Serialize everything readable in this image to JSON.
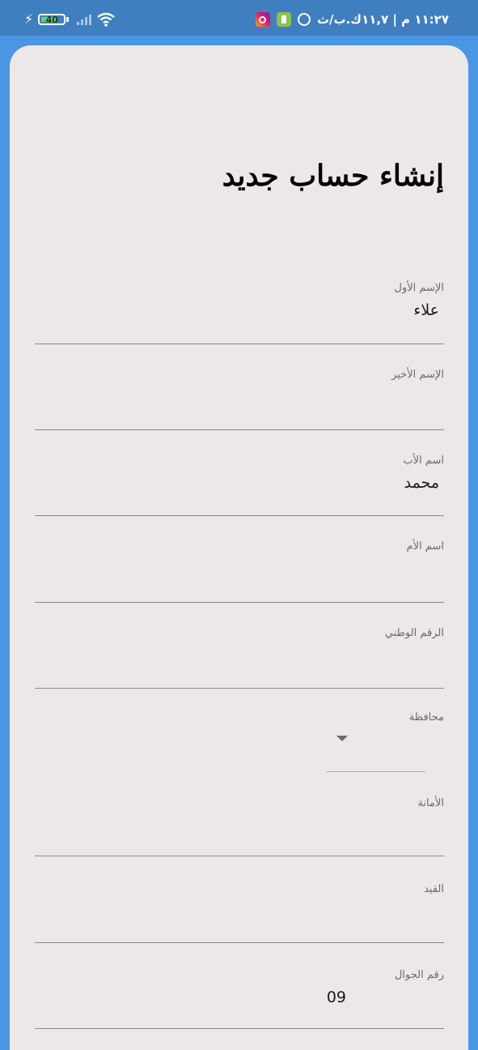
{
  "status_bar": {
    "battery_level": "40",
    "time_text": "١١:٢٧ م | ١١,٧ك.ب/ث",
    "icons": [
      "charging-bolt-icon",
      "battery-icon",
      "signal-icon",
      "wifi-icon",
      "instagram-icon",
      "app-icon",
      "alarm-icon"
    ]
  },
  "form": {
    "title": "إنشاء حساب جديد",
    "fields": [
      {
        "label": "الإسم الأول",
        "value": "علاء"
      },
      {
        "label": "الإسم الأخير",
        "value": ""
      },
      {
        "label": "اسم الأب",
        "value": "محمد"
      },
      {
        "label": "اسم الأم",
        "value": ""
      },
      {
        "label": "الرقم الوطني",
        "value": ""
      },
      {
        "label": "محافظة",
        "value": ""
      },
      {
        "label": "الأمانة",
        "value": ""
      },
      {
        "label": "القيد",
        "value": ""
      },
      {
        "label": "رقم الجوال",
        "value": "09"
      }
    ]
  },
  "colors": {
    "background": "#4a96e3",
    "status_bar": "#3f7fc0",
    "card": "#ede8e8",
    "battery_fill": "#6cd34a"
  }
}
